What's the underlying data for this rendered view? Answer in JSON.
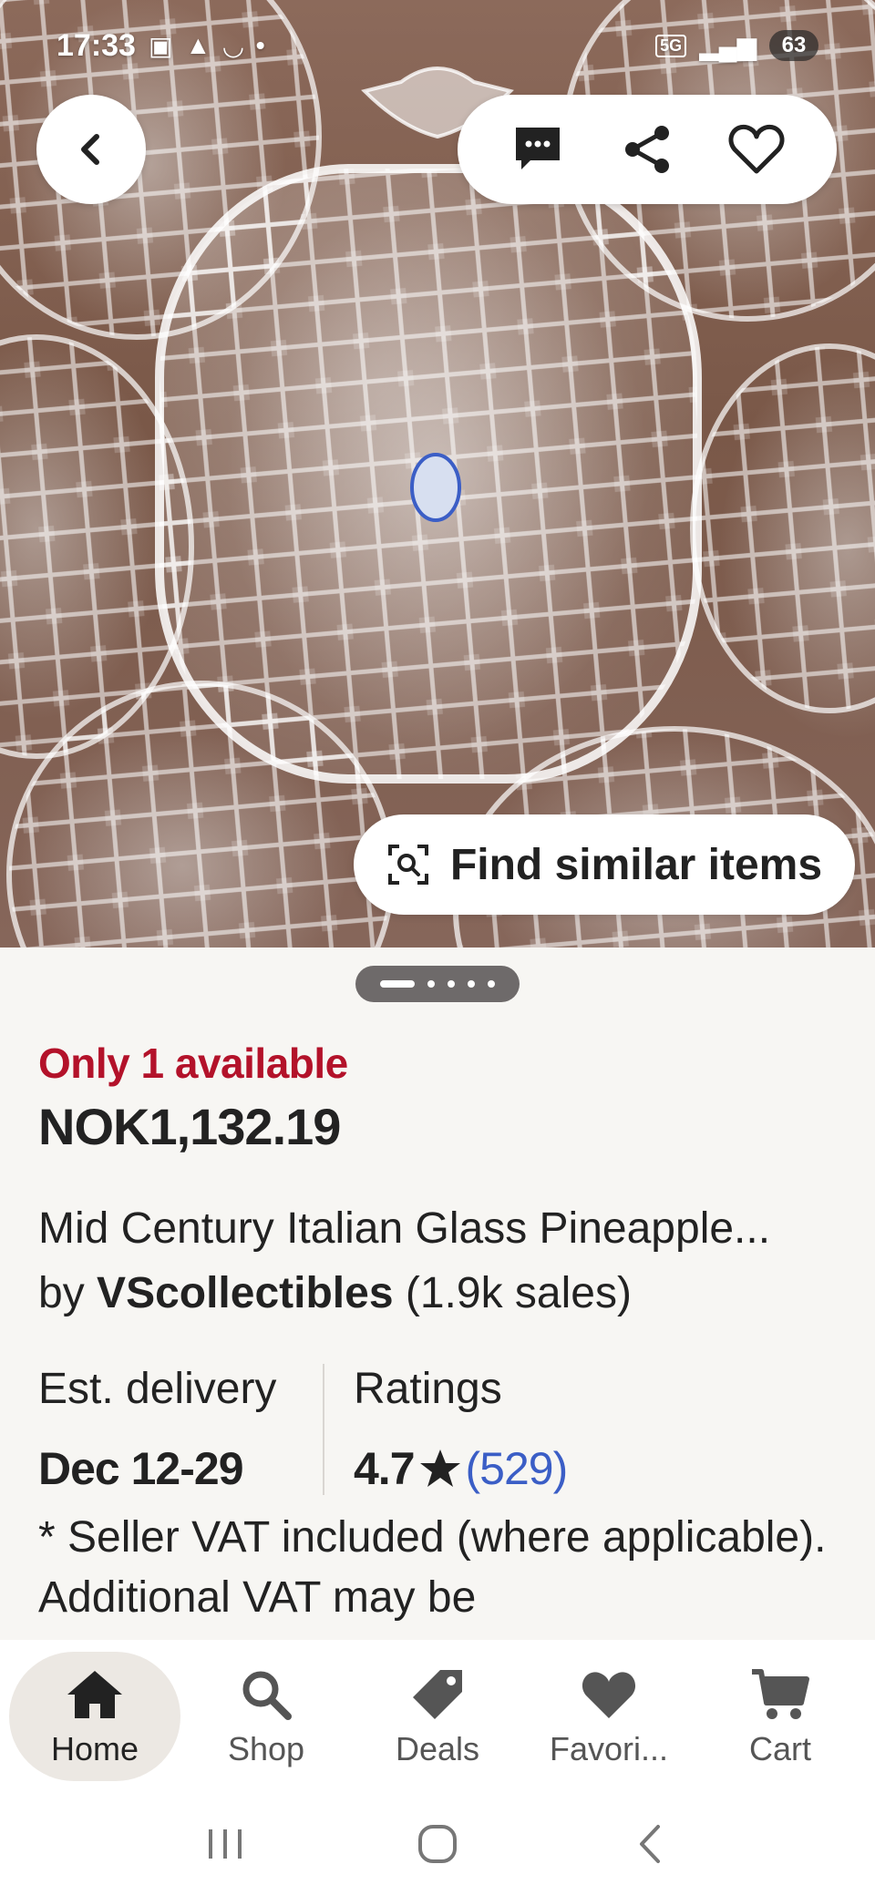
{
  "status_bar": {
    "time": "17:33",
    "network": "5G",
    "battery": "63"
  },
  "hero": {
    "find_similar_label": "Find similar items"
  },
  "carousel": {
    "dot_count": 5,
    "active_index": 0
  },
  "listing": {
    "availability": "Only 1 available",
    "price": "NOK1,132.19",
    "title": "Mid Century Italian Glass Pineapple...",
    "by_prefix": "by",
    "shop_name": "VScollectibles",
    "sales": "(1.9k sales)",
    "delivery_label": "Est. delivery",
    "delivery_value": "Dec 12-29",
    "ratings_label": "Ratings",
    "rating_value": "4.7",
    "rating_count": "(529)",
    "vat_note": "* Seller VAT included (where applicable). Additional VAT may be"
  },
  "bottom_nav": {
    "items": [
      {
        "label": "Home",
        "icon": "home-icon",
        "active": true
      },
      {
        "label": "Shop",
        "icon": "search-icon",
        "active": false
      },
      {
        "label": "Deals",
        "icon": "tag-icon",
        "active": false
      },
      {
        "label": "Favori...",
        "icon": "heart-icon",
        "active": false
      },
      {
        "label": "Cart",
        "icon": "cart-icon",
        "active": false
      }
    ]
  },
  "colors": {
    "availability": "#b3122a",
    "rating_link": "#3b5ec6",
    "nav_active_bg": "#ece8e3"
  }
}
